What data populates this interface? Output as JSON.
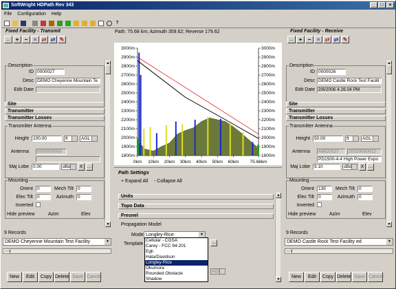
{
  "window": {
    "title": "SoftWright HDPath Rev 343"
  },
  "menu": [
    "File",
    "Configuration",
    "Help"
  ],
  "path_info": "Path: 75.68 km; Azimuth 359.62; Reverse 179.62",
  "left": {
    "title": "Fixed Facility - Transmit",
    "description": {
      "title": "Description",
      "id_label": "ID",
      "id": "0000027",
      "desc_label": "Desc",
      "desc": "DEMO Cheyenne Mountain Te",
      "edit_label": "Edit Date",
      "edit": ""
    },
    "sections": [
      "Site",
      "Transmitter",
      "Transmitter Losses"
    ],
    "antenna": {
      "title": "Transmitter Antenna",
      "height_label": "Height",
      "height": "100.00",
      "unit": "ft",
      "ref": "AGL",
      "antenna_label": "Antenna",
      "antenna_val": "0000000000",
      "maj_label": "Maj Lobe",
      "maj": "0.00",
      "maj_unit": "dBd",
      "x": "X"
    },
    "mounting": {
      "title": "Mounting",
      "orient_label": "Orient",
      "orient": "0",
      "mech_label": "Mech Tilt",
      "mech": "0",
      "elec_label": "Elec Tilt",
      "elec": "0",
      "azimuth_label": "Azimuth",
      "azimuth": "0",
      "inverted_label": "Inverted",
      "hide_label": "Hide preview",
      "azim_label": "Azim",
      "elev_label": "Elev"
    },
    "records": "9 Records",
    "combo": "DEMO Cheyenne Mountain Test Facility",
    "buttons": [
      "New",
      "Edit",
      "Copy",
      "Delete",
      "Save",
      "Cancel"
    ]
  },
  "right": {
    "title": "Fixed Facility - Receive",
    "description": {
      "title": "Description",
      "id_label": "ID",
      "id": "0000026",
      "desc_label": "Desc",
      "desc": "DEMO Castle Rock Test Facilit",
      "edit_label": "Edit Date",
      "edit": "2/6/2006 4.26.04 PM"
    },
    "sections": [
      "Site",
      "Transmitter",
      "Transmitter Losses"
    ],
    "antenna": {
      "title": "Transmitter Antenna",
      "height_label": "Height",
      "height": "50.00",
      "unit": "ft",
      "ref": "AGL",
      "antenna_label": "Antenna",
      "antenna_id1": "AMI20027",
      "antenna_id2": "20020000012",
      "antenna_desc": "PD1500-4-4 High Power Expo",
      "maj_label": "Maj Lobe",
      "maj": "9.10",
      "maj_unit": "dBd",
      "x": "X"
    },
    "mounting": {
      "title": "Mounting",
      "orient_label": "Orient",
      "orient": "135",
      "mech_label": "Mech Tilt",
      "mech": "0",
      "elec_label": "Elec Tilt",
      "elec": "0",
      "azimuth_label": "Azimuth",
      "azimuth": "0",
      "inverted_label": "Inverted",
      "hide_label": "Hide preview",
      "azim_label": "Azim",
      "elev_label": "Elev"
    },
    "records": "9 Records",
    "combo": "DEMO Castle Rock Test Facility ed",
    "buttons": [
      "New",
      "Edit",
      "Copy",
      "Delete",
      "Save",
      "Cancel"
    ]
  },
  "chart_data": {
    "type": "area",
    "x": [
      0,
      5,
      10,
      15,
      20,
      25,
      30,
      35,
      40,
      45,
      50,
      55,
      60,
      65,
      70,
      75.68
    ],
    "terrain": [
      1960,
      1870,
      1850,
      1900,
      1940,
      2040,
      2080,
      2110,
      2180,
      2220,
      2200,
      2180,
      2120,
      2050,
      1970,
      1880
    ],
    "xlabels": [
      "0km",
      "10km",
      "20km",
      "30km",
      "40km",
      "50km",
      "60km",
      "75.68km"
    ],
    "ylabels": [
      "3000m",
      "2900m",
      "2800m",
      "2700m",
      "2600m",
      "2500m",
      "2400m",
      "2300m",
      "2200m",
      "2100m",
      "2000m",
      "1900m",
      "1800m"
    ],
    "ylim": [
      1800,
      3000
    ],
    "line_of_sight": [
      [
        0,
        2900
      ],
      [
        75.68,
        2040
      ]
    ],
    "earth_curve_top": [
      [
        0,
        2860
      ],
      [
        30,
        2450
      ],
      [
        60,
        2150
      ],
      [
        75.68,
        1990
      ]
    ]
  },
  "settings": {
    "title": "Path Settings",
    "expand": "+ Expand All",
    "collapse": "- Collapse All",
    "sections": [
      "Units",
      "Topo Data",
      "Fresnel"
    ],
    "prop_title": "Propagation Model",
    "model_label": "Model",
    "model": "Longley-Rice",
    "template_label": "Template",
    "options": [
      "Cellular - CGSA",
      "Carey - FCC 94-201",
      "Egli",
      "Hata/Davidson",
      "Longley-Rice",
      "Okumura",
      "Rounded Obstacle",
      "Shadow"
    ],
    "agl": "AGL"
  }
}
